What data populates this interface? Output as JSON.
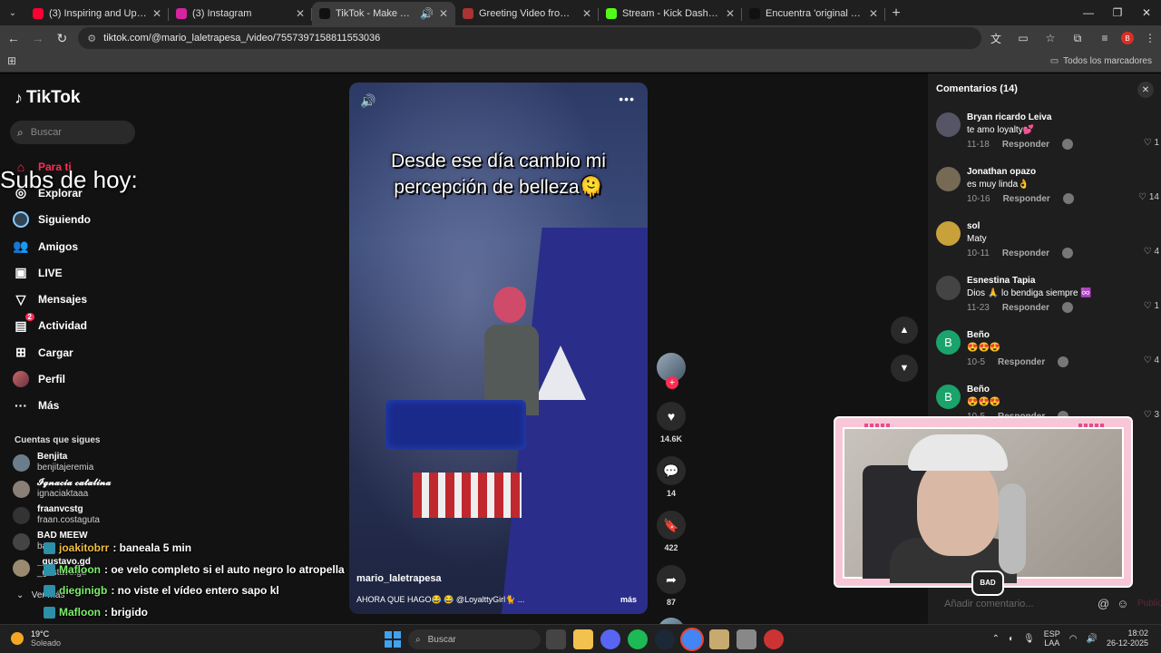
{
  "browser": {
    "tabs": [
      {
        "title": "(3) Inspiring and Uplifting Back",
        "color": "#ff0033",
        "active": false
      },
      {
        "title": "(3) Instagram",
        "color": "#d6249f",
        "active": false
      },
      {
        "title": "TikTok - Make Your Day",
        "color": "#111111",
        "active": true
      },
      {
        "title": "Greeting Video from Africa – de",
        "color": "#a33",
        "active": false
      },
      {
        "title": "Stream - Kick Dashboard",
        "color": "#53fc18",
        "active": false
      },
      {
        "title": "Encuentra 'original en que asp",
        "color": "#111111",
        "active": false
      }
    ],
    "url": "tiktok.com/@mario_laletrapesa_/video/7557397158811553036",
    "all_bookmarks": "Todos los marcadores",
    "profile_initial": "B"
  },
  "sidebar": {
    "logo": "TikTok",
    "search_placeholder": "Buscar",
    "nav": [
      {
        "label": "Para ti",
        "icon": "home-icon"
      },
      {
        "label": "Explorar",
        "icon": "compass-icon"
      },
      {
        "label": "Siguiendo",
        "icon": "following-icon"
      },
      {
        "label": "Amigos",
        "icon": "friends-icon"
      },
      {
        "label": "LIVE",
        "icon": "live-icon"
      },
      {
        "label": "Mensajes",
        "icon": "messages-icon"
      },
      {
        "label": "Actividad",
        "icon": "activity-icon",
        "badge": "2"
      },
      {
        "label": "Cargar",
        "icon": "upload-icon"
      },
      {
        "label": "Perfil",
        "icon": "profile-icon"
      },
      {
        "label": "Más",
        "icon": "more-icon"
      }
    ],
    "following_title": "Cuentas que sigues",
    "following": [
      {
        "name": "Benjita",
        "handle": "benjitajeremia"
      },
      {
        "name": "𝓘𝓰𝓷𝓪𝓬𝓲𝓪 𝓬𝓪𝓽𝓪𝓵𝓲𝓷𝓪",
        "handle": "ignaciaktaaa"
      },
      {
        "name": "fraanvcstg",
        "handle": "fraan.costaguta"
      },
      {
        "name": "BAD MEEW",
        "handle": "ba"
      },
      {
        "name": "_gustavo.gd",
        "handle": "_gustavo.gd"
      }
    ],
    "see_more": "Ver más"
  },
  "overlay": {
    "subs_title": "Subs de hoy:",
    "chat": [
      {
        "user": "joakitobrr",
        "message": ": baneala 5 min",
        "color": "y"
      },
      {
        "user": "Mafloon",
        "message": ": oe velo completo si el auto negro lo atropella",
        "color": "g"
      },
      {
        "user": "dieginigb",
        "message": ": no viste el vídeo entero sapo kl",
        "color": "g"
      },
      {
        "user": "Mafloon",
        "message": ": brigido",
        "color": "g"
      }
    ]
  },
  "video": {
    "caption": "Desde ese día cambio mi percepción de belleza🫠",
    "author": "mario_laletrapesa",
    "description": "AHORA QUE HAGO😂 😂 @LoyalttyGirl🐈 ...",
    "more": "más",
    "likes": "14.6K",
    "comments": "14",
    "saves": "422",
    "shares": "87"
  },
  "comments_panel": {
    "title": "Comentarios (14)",
    "reply_label": "Responder",
    "add_placeholder": "Añadir comentario...",
    "publish": "Publicar",
    "items": [
      {
        "name": "Bryan ricardo Leiva",
        "text": "te amo loyalty💕",
        "date": "11-18",
        "likes": "1",
        "avatar": "#556"
      },
      {
        "name": "Jonathan opazo",
        "text": "es muy linda👌",
        "date": "10-16",
        "likes": "14",
        "avatar": "#776a55"
      },
      {
        "name": "sol",
        "text": "Maty",
        "date": "10-11",
        "likes": "4",
        "avatar": "#c9a13a"
      },
      {
        "name": "Esnestina Tapia",
        "text": "Dios 🙏 lo bendiga siempre ♾️",
        "date": "11-23",
        "likes": "1",
        "avatar": "#444"
      },
      {
        "name": "Beño",
        "text": "😍😍😍",
        "date": "10-5",
        "likes": "4",
        "avatar": "#1aa36b",
        "initial": "B"
      },
      {
        "name": "Beño",
        "text": "😍😍😍",
        "date": "10-5",
        "likes": "3",
        "avatar": "#1aa36b",
        "initial": "B"
      }
    ]
  },
  "webcam": {
    "logo_text": "BAD"
  },
  "taskbar": {
    "temp": "19°C",
    "weather": "Soleado",
    "search": "Buscar",
    "lang1": "ESP",
    "lang2": "LAA",
    "time": "18:02",
    "date": "26-12-2025"
  }
}
